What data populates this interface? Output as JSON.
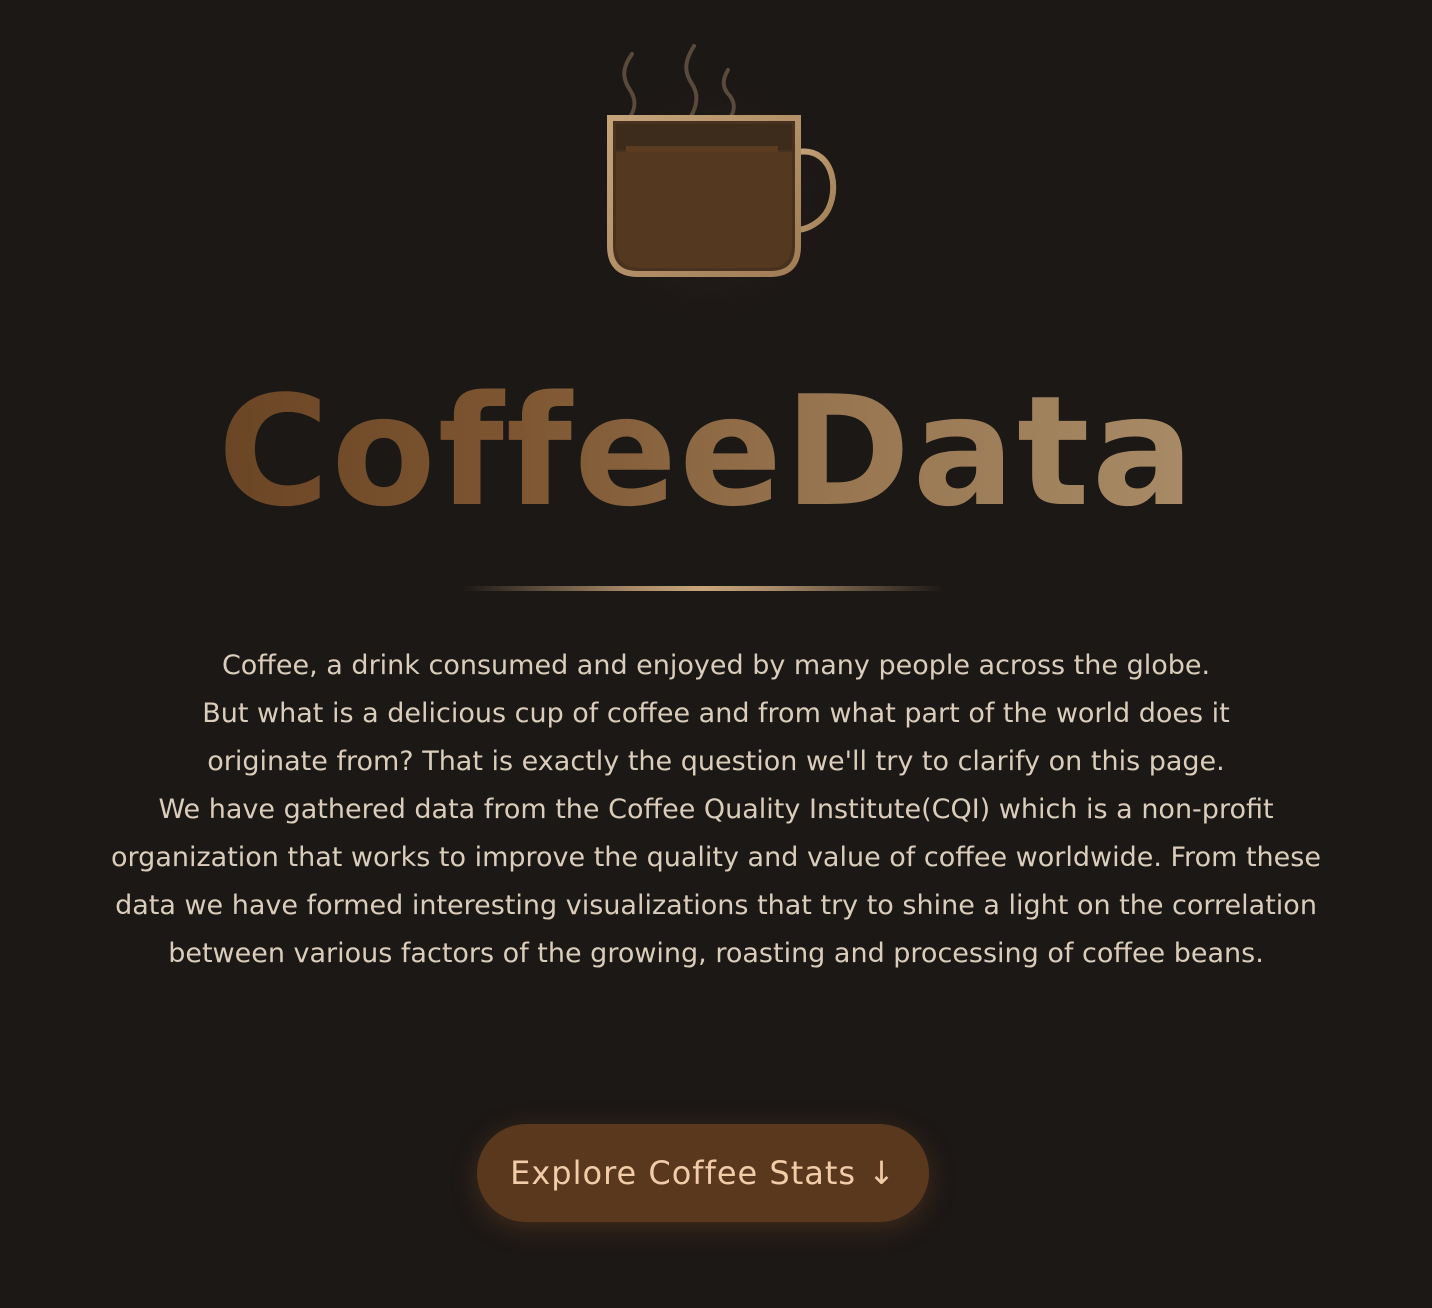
{
  "hero": {
    "logo_icon": "coffee-cup-icon",
    "title": "CoffeeData",
    "intro_lines": [
      "Coffee, a drink consumed and enjoyed by many people across the globe.",
      "But what is a delicious cup of coffee and from what part of the world does it",
      "originate from? That is exactly the question we'll try to clarify on this page.",
      "We have gathered data from the Coffee Quality Institute(CQI) which is a non-profit",
      "organization that works to improve the quality and value of coffee worldwide. From these",
      "data we have formed interesting visualizations that try to shine a light on the correlation",
      "between various factors of the growing, roasting and processing of coffee beans."
    ],
    "cta_label": "Explore Coffee Stats",
    "cta_icon": "arrow-down-icon",
    "cta_arrow": "↓"
  },
  "colors": {
    "background": "#1c1816",
    "title_gradient_start": "#6a4525",
    "title_gradient_end": "#a88b67",
    "intro_text": "#dbcdbb",
    "cta_background": "#5a381e",
    "cta_text": "#f2cba8",
    "cup_rim": "#c6a47a",
    "cup_coffee": "#54381f"
  }
}
